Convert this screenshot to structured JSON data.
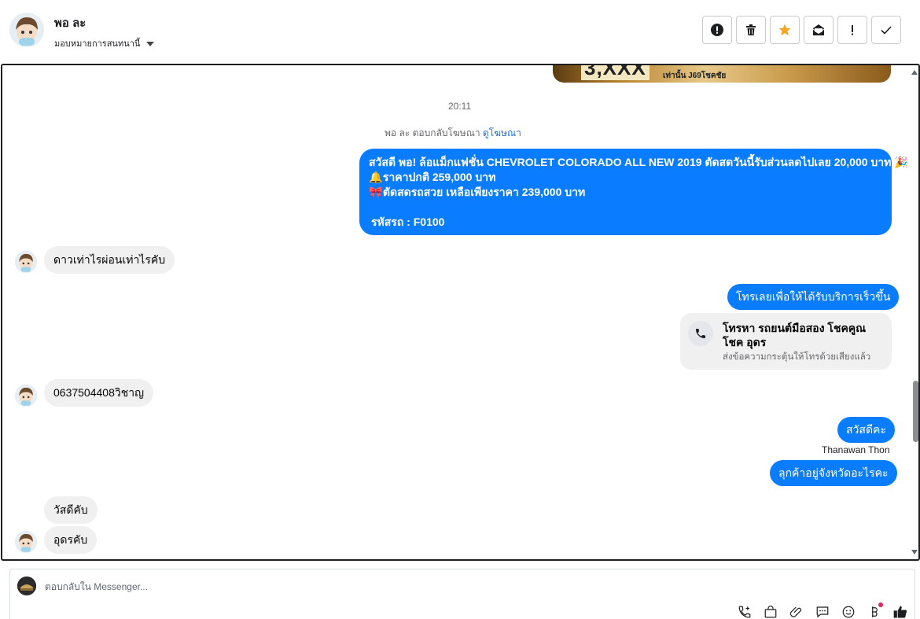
{
  "header": {
    "contact_name": "พอ ละ",
    "assign_label": "มอบหมายการสนทนานี้"
  },
  "thread": {
    "ad_image": {
      "number": "3,XXX",
      "caption": "เท่านั้น J69โชคชัย"
    },
    "timestamp": "20:11",
    "reply_note": {
      "prefix": "พอ ละ ตอบกลับโฆษณา",
      "link": "ดูโฆษณา"
    },
    "ad_message": {
      "line1": "สวัสดี พอ! ล้อแม็กแฟชั่น CHEVROLET COLORADO ALL NEW 2019 ตัดสดวันนี้รับส่วนลดไปเลย 20,000 บาท",
      "line2": "ราคาปกติ 259,000 บาท",
      "line3": "ตัดสดรถสวย เหลือเพียงราคา 239,000 บาท",
      "line4": "รหัสรถ : F0100",
      "emoji_party": "🎉",
      "emoji_bell": "🔔",
      "emoji_bow": "🎀"
    },
    "msg_in_1": "ดาวเท่าไรผ่อนเท่าไรคับ",
    "msg_out_1": "โทรเลยเพื่อให้ได้รับบริการเร็วขึ้น",
    "call_card": {
      "title": "โทรหา รถยนต์มือสอง โชคคูณโชค อุดร",
      "subtitle": "ส่งข้อความกระตุ้นให้โทรด้วยเสียงแล้ว"
    },
    "msg_in_2": "0637504408วิชาญ",
    "msg_out_2": "สวัสดีคะ",
    "sender_name": "Thanawan Thon",
    "msg_out_3": "ลุกค้าอยู่จังหวัดอะไรคะ",
    "msg_in_3": "วัสดีคับ",
    "msg_in_4": "อุดรคับ"
  },
  "composer": {
    "placeholder": "ตอบกลับใน Messenger..."
  },
  "colors": {
    "outgoing_bubble": "#0a7cff",
    "incoming_bubble": "#f0f0f0",
    "star": "#f5a623",
    "link": "#216fdb"
  }
}
